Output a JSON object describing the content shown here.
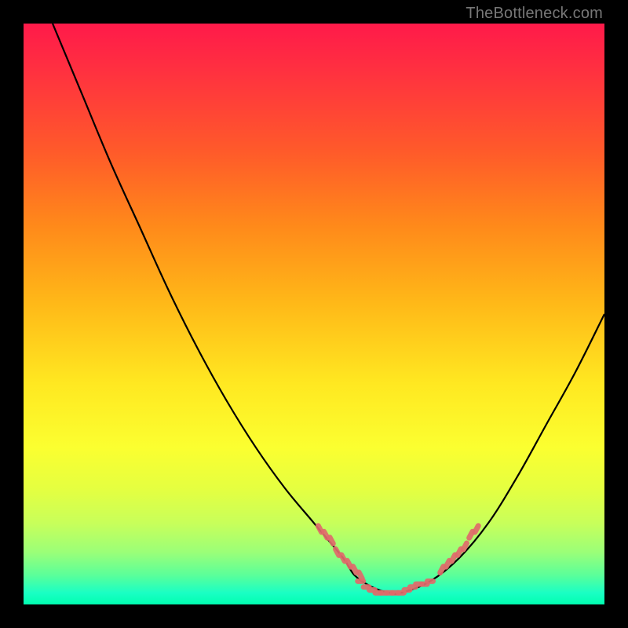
{
  "watermark": "TheBottleneck.com",
  "chart_data": {
    "type": "line",
    "title": "",
    "xlabel": "",
    "ylabel": "",
    "xlim": [
      0,
      100
    ],
    "ylim": [
      0,
      100
    ],
    "background_gradient": {
      "orientation": "vertical",
      "stops": [
        {
          "pos": 0,
          "color": "#ff1a4a"
        },
        {
          "pos": 22,
          "color": "#ff5a2a"
        },
        {
          "pos": 48,
          "color": "#ffb818"
        },
        {
          "pos": 73,
          "color": "#fbff30"
        },
        {
          "pos": 91,
          "color": "#9bff78"
        },
        {
          "pos": 100,
          "color": "#00ffb0"
        }
      ]
    },
    "series": [
      {
        "name": "bottleneck-curve",
        "color": "#000000",
        "x": [
          5,
          10,
          15,
          20,
          25,
          30,
          35,
          40,
          45,
          50,
          55,
          57,
          60,
          63,
          65,
          70,
          75,
          80,
          85,
          90,
          95,
          100
        ],
        "values": [
          100,
          88,
          76,
          65,
          54,
          44,
          35,
          27,
          20,
          14,
          8,
          5,
          3,
          2,
          2,
          4,
          8,
          14,
          22,
          31,
          40,
          50
        ]
      }
    ],
    "highlight_regions": [
      {
        "name": "left-dots",
        "color": "#e06a6a",
        "x": [
          51,
          52,
          53,
          54,
          55,
          56,
          57,
          58
        ],
        "values": [
          13,
          12,
          11,
          9,
          8,
          7,
          6,
          5
        ]
      },
      {
        "name": "bottom-dots",
        "color": "#e06a6a",
        "x": [
          58,
          59,
          60,
          61,
          62,
          63,
          64,
          65,
          66,
          67,
          68,
          69,
          70
        ],
        "values": [
          4,
          3,
          2.5,
          2,
          2,
          2,
          2,
          2,
          2.5,
          3,
          3.5,
          3.5,
          4
        ]
      },
      {
        "name": "right-dots",
        "color": "#e06a6a",
        "x": [
          72,
          73,
          74,
          75,
          76,
          77,
          78
        ],
        "values": [
          6,
          7,
          8,
          9,
          10,
          12,
          13
        ]
      }
    ]
  }
}
